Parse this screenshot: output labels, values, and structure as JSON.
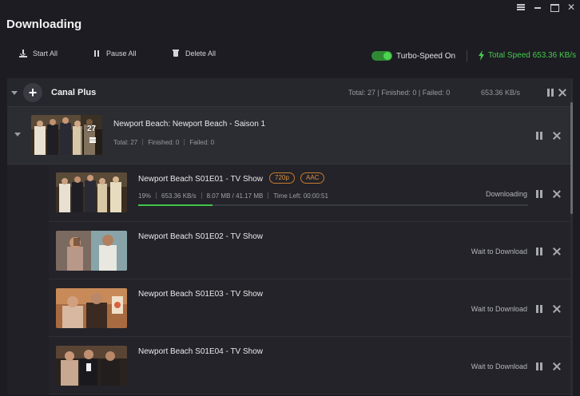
{
  "app": {
    "title": "Downloading"
  },
  "toolbar": {
    "start_all": "Start All",
    "pause_all": "Pause All",
    "delete_all": "Delete All",
    "turbo_label": "Turbo-Speed On",
    "turbo_on": true,
    "total_speed": "Total Speed 653.36 KB/s"
  },
  "group": {
    "name": "Canal Plus",
    "stats": "Total: 27 | Finished: 0 | Failed: 0",
    "speed": "653.36 KB/s"
  },
  "season": {
    "title": "Newport Beach: Newport Beach - Saison 1",
    "count_badge": "27",
    "total": "Total: 27",
    "finished": "Finished: 0",
    "failed": "Failed: 0"
  },
  "episodes": [
    {
      "title": "Newport Beach S01E01 - TV Show",
      "tags": [
        "720p",
        "AAC"
      ],
      "percent": "19%",
      "speed": "653.36 KB/s",
      "size": "8.07 MB / 41.17 MB",
      "time_left": "Time Left: 00:00:51",
      "progress": 0.19,
      "status": "Downloading"
    },
    {
      "title": "Newport Beach S01E02 - TV Show",
      "status": "Wait to Download"
    },
    {
      "title": "Newport Beach S01E03 - TV Show",
      "status": "Wait to Download"
    },
    {
      "title": "Newport Beach S01E04 - TV Show",
      "status": "Wait to Download"
    }
  ],
  "colors": {
    "accent_green": "#47c94c",
    "tag_orange": "#e0913e",
    "background": "#1c1c22"
  }
}
